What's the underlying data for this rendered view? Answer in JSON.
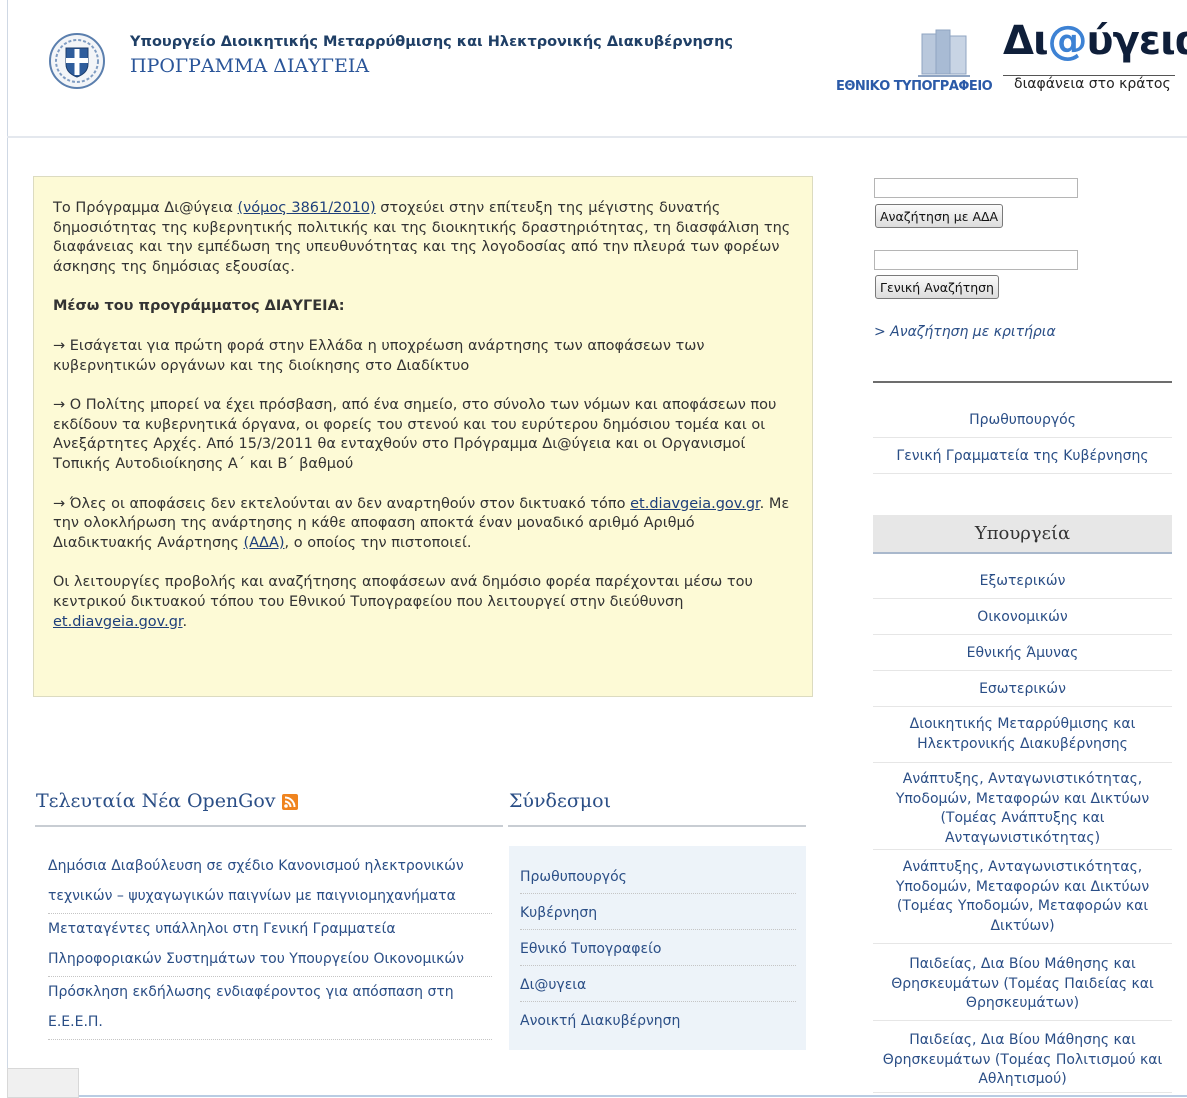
{
  "header": {
    "ministry": "Υπουργείο Διοικητικής Μεταρρύθμισης και Ηλεκτρονικής Διακυβέρνησης",
    "program": "ΠΡΟΓΡΑΜΜΑ ΔΙΑΥΓΕΙΑ",
    "brand_prefix": "Δι",
    "brand_at": "@",
    "brand_suffix": "ύγεια",
    "brand_tagline": "διαφάνεια στο κράτος",
    "printing_office": "ΕΘΝΙΚΟ ΤΥΠΟΓΡΑΦΕΙΟ"
  },
  "intro": {
    "p1_before": "Το Πρόγραμμα Δι@ύγεια ",
    "p1_link": "(νόμος 3861/2010)",
    "p1_after": " στοχεύει στην επίτευξη της μέγιστης δυνατής δημοσιότητας της κυβερνητικής πολιτικής και της διοικητικής δραστηριότητας, τη διασφάλιση της διαφάνειας και την εμπέδωση της υπευθυνότητας και της λογοδοσίας από την πλευρά των φορέων άσκησης της δημόσιας εξουσίας.",
    "heading": "Μέσω του προγράμματος ΔΙΑΥΓΕΙΑ:",
    "bullet1": "→ Εισάγεται για πρώτη φορά στην Ελλάδα η υποχρέωση ανάρτησης των αποφάσεων των κυβερνητικών οργάνων και της διοίκησης στο Διαδίκτυο",
    "bullet2": "→ Ο Πολίτης μπορεί να έχει πρόσβαση, από ένα σημείο, στο σύνολο των νόμων και αποφάσεων που εκδίδουν τα κυβερνητικά όργανα, οι φορείς του στενού και του ευρύτερου δημόσιου τομέα και οι Ανεξάρτητες Αρχές. Από 15/3/2011 θα ενταχθούν στο Πρόγραμμα Δι@ύγεια και οι Οργανισμοί Τοπικής Αυτοδιοίκησης Α΄ και Β΄ βαθμού",
    "bullet3_before": "→ Όλες οι αποφάσεις δεν εκτελούνται αν δεν αναρτηθούν στον δικτυακό τόπο ",
    "bullet3_link": "et.diavgeia.gov.gr",
    "bullet3_middle": ". Με την ολοκλήρωση της ανάρτησης η κάθε αποφαση αποκτά έναν μοναδικό αριθμό Αριθμό Διαδικτυακής Ανάρτησης ",
    "bullet3_link2": "(ΑΔΑ)",
    "bullet3_after": ", ο οποίος την πιστοποιεί.",
    "p_last_before": "Οι λειτουργίες προβολής και αναζήτησης αποφάσεων ανά δημόσιο φορέα παρέχονται μέσω του κεντρικού δικτυακού τόπου του Εθνικού Τυπογραφείου που λειτουργεί στην διεύθυνση ",
    "p_last_link": "et.diavgeia.gov.gr",
    "p_last_after": "."
  },
  "search": {
    "ada_value": "",
    "ada_button": "Αναζήτηση με ΑΔΑ",
    "general_value": "",
    "general_button": "Γενική Αναζήτηση",
    "criteria_link": "> Αναζήτηση με κριτήρια"
  },
  "top_links": [
    "Πρωθυπουργός",
    "Γενική Γραμματεία της Κυβέρνησης"
  ],
  "ministries": {
    "heading": "Υπουργεία",
    "items": [
      "Εξωτερικών",
      "Οικονομικών",
      "Εθνικής Άμυνας",
      "Εσωτερικών",
      "Διοικητικής Μεταρρύθμισης και Ηλεκτρονικής Διακυβέρνησης",
      "Ανάπτυξης, Ανταγωνιστικότητας, Υποδομών, Μεταφορών και Δικτύων (Τομέας Ανάπτυξης και Ανταγωνιστικότητας)",
      "Ανάπτυξης, Ανταγωνιστικότητας, Υποδομών, Μεταφορών και Δικτύων (Τομέας Υποδομών, Μεταφορών και Δικτύων)",
      "Παιδείας, Δια Βίου Μάθησης και Θρησκευμάτων (Τομέας Παιδείας και Θρησκευμάτων)",
      "Παιδείας, Δια Βίου Μάθησης και Θρησκευμάτων (Τομέας Πολιτισμού και Αθλητισμού)"
    ]
  },
  "news": {
    "title": "Τελευταία Νέα OpenGov",
    "items": [
      "Δημόσια Διαβούλευση σε σχέδιο Κανονισμού ηλεκτρονικών τεχνικών – ψυχαγωγικών παιγνίων με παιγνιομηχανήματα",
      "Μεταταγέντες υπάλληλοι στη Γενική Γραμματεία Πληροφοριακών Συστημάτων του Υπουργείου Οικονομικών",
      "Πρόσκληση εκδήλωσης ενδιαφέροντος για απόσπαση στη Ε.Ε.Ε.Π."
    ]
  },
  "links": {
    "title": "Σύνδεσμοι",
    "items": [
      "Πρωθυπουργός",
      "Κυβέρνηση",
      "Εθνικό Τυπογραφείο",
      "Δι@υγεια",
      "Ανοικτή Διακυβέρνηση"
    ]
  },
  "colors": {
    "accent": "#2a4e86",
    "intro_bg": "#fdfad6",
    "links_bg": "#edf3f9",
    "rss": "#f0841e"
  }
}
